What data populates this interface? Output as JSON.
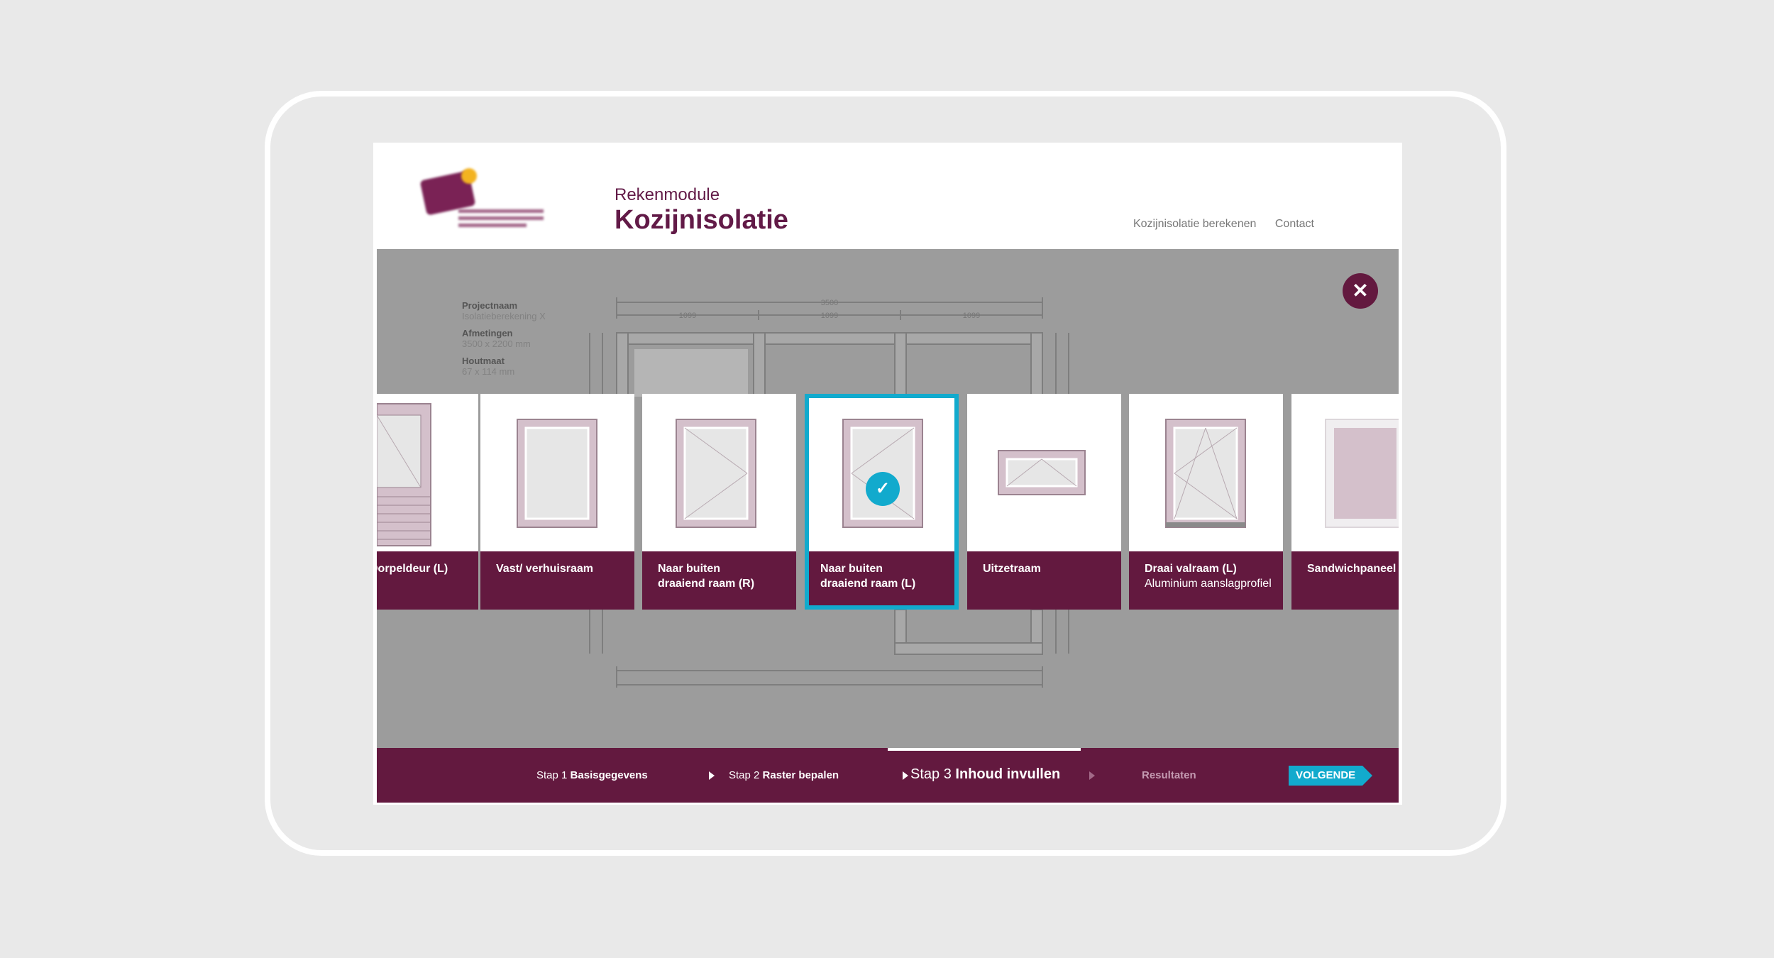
{
  "header": {
    "subtitle": "Rekenmodule",
    "title": "Kozijnisolatie",
    "nav": [
      "Kozijnisolatie berekenen",
      "Contact"
    ]
  },
  "info": {
    "project_label": "Projectnaam",
    "project_value": "Isolatieberekening X",
    "dims_label": "Afmetingen",
    "dims_value": "3500 x 2200 mm",
    "wood_label": "Houtmaat",
    "wood_value": "67 x 114 mm"
  },
  "drawing": {
    "total_width": "3500",
    "segments": [
      "1099",
      "1099",
      "1099"
    ]
  },
  "cards": [
    {
      "label_line1": "Dorpeldeur (L)",
      "label_line2": "",
      "sub": ""
    },
    {
      "label_line1": "Vast/ verhuisraam",
      "label_line2": "",
      "sub": ""
    },
    {
      "label_line1": "Naar buiten",
      "label_line2": "draaiend raam (R)",
      "sub": ""
    },
    {
      "label_line1": "Naar buiten",
      "label_line2": "draaiend raam (L)",
      "sub": "",
      "selected": true
    },
    {
      "label_line1": "Uitzetraam",
      "label_line2": "",
      "sub": ""
    },
    {
      "label_line1": "Draai valraam (L)",
      "label_line2": "",
      "sub": "Aluminium aanslagprofiel"
    },
    {
      "label_line1": "Sandwichpaneel",
      "label_line2": "",
      "sub": ""
    }
  ],
  "steps": {
    "step1_prefix": "Stap 1",
    "step1_name": "Basisgegevens",
    "step2_prefix": "Stap 2",
    "step2_name": "Raster bepalen",
    "step3_prefix": "Stap 3",
    "step3_name": "Inhoud invullen",
    "results": "Resultaten",
    "next": "VOLGENDE"
  },
  "colors": {
    "brand": "#63193f",
    "accent": "#12aacd",
    "frame": "#d4c0cb"
  }
}
